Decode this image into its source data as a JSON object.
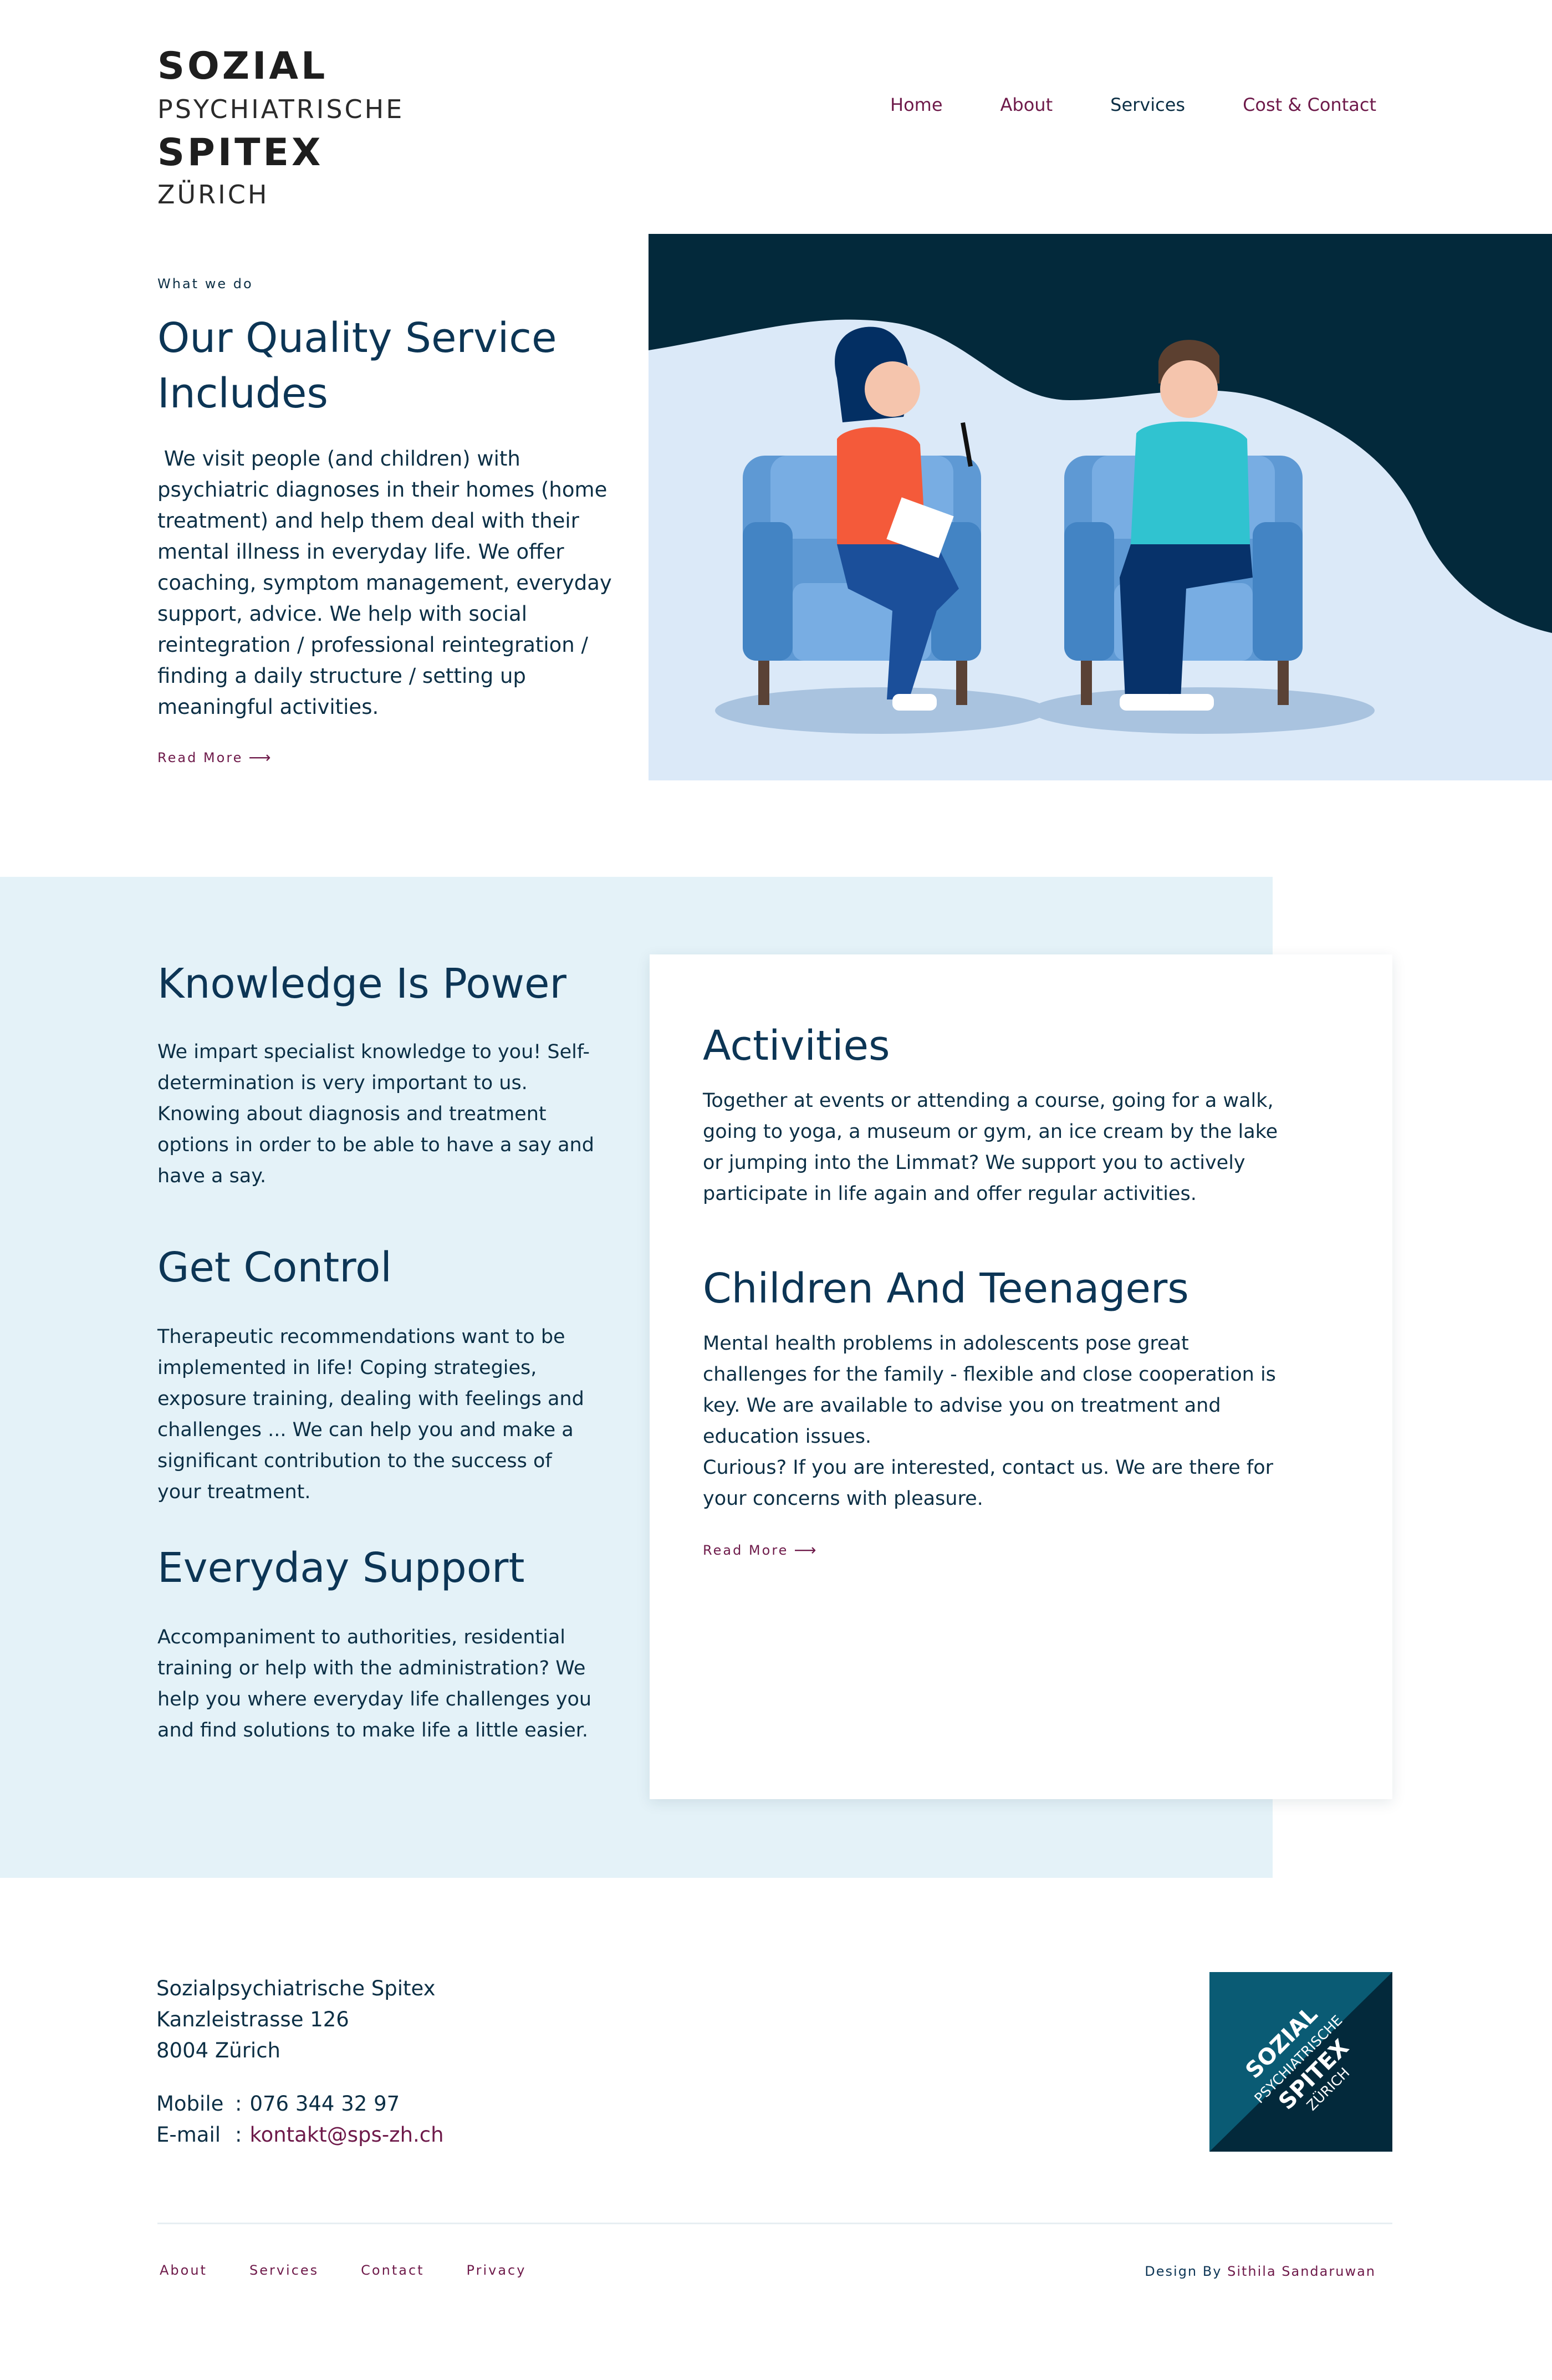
{
  "logo": {
    "line1": "SOZIAL",
    "line2": "PSYCHIATRISCHE",
    "line3": "SPITEX",
    "line4": "ZÜRICH"
  },
  "nav": [
    {
      "label": "Home"
    },
    {
      "label": "About"
    },
    {
      "label": "Services"
    },
    {
      "label": "Cost & Contact"
    }
  ],
  "hero": {
    "eyebrow": "What we do",
    "title": "Our Quality Service Includes",
    "text": " We visit people (and children) with psychiatric diagnoses in their homes (home treatment) and help them deal with their mental illness in everyday life. We offer coaching, symptom management, everyday support, advice. We help with social reintegration / professional reintegration / finding a daily structure / setting up meaningful activities.",
    "read_more": "Read More"
  },
  "services": {
    "knowledge": {
      "title": "Knowledge Is Power",
      "text": "We impart specialist knowledge to you! Self-determination is very important to us. Knowing about diagnosis and treatment options in order to be able to have a say and have a say."
    },
    "control": {
      "title": "Get Control",
      "text": "Therapeutic recommendations want to be implemented in life! Coping strategies, exposure training, dealing with feelings and challenges ... We can help you and make a significant contribution to the success of your treatment."
    },
    "everyday": {
      "title": "Everyday Support",
      "text": "Accompaniment to authorities, residential training or help with the administration? We help you where everyday life challenges you and find solutions to make life a little easier."
    },
    "activities": {
      "title": "Activities",
      "text": "Together at events or attending a course, going for a walk, going to yoga, a museum or gym, an ice cream by the lake or jumping into the Limmat? We support you to actively participate in life again and offer regular activities."
    },
    "children": {
      "title": "Children And Teenagers",
      "text": "Mental health problems in adolescents pose great challenges for the family - flexible and close cooperation is key. We are available to advise you on treatment and education issues.\nCurious? If you are interested, contact us. We are there for your concerns with pleasure."
    },
    "read_more": "Read More"
  },
  "footer": {
    "address": [
      "Sozialpsychiatrische Spitex",
      "Kanzleistrasse 126",
      "8004 Zürich"
    ],
    "mobile_label": "Mobile",
    "mobile": "076 344 32 97",
    "email_label": "E-mail",
    "email": "kontakt@sps-zh.ch",
    "badge": {
      "line1": "SOZIAL",
      "line2": "PSYCHIATRISCHE",
      "line3": "SPITEX",
      "line4": "ZÜRICH"
    },
    "links": [
      "About",
      "Services",
      "Contact",
      "Privacy"
    ],
    "credit_prefix": "Design By ",
    "credit_name": "Sithila Sandaruwan"
  },
  "colors": {
    "navy": "#0c3555",
    "accent": "#6e1a4a",
    "band": "#e4f2f8",
    "hero_dark": "#03293b",
    "hero_light": "#dbe9f8",
    "badge_teal": "#0a5b74",
    "badge_dark": "#03293b"
  },
  "icons": [
    "arrow-right-icon"
  ]
}
